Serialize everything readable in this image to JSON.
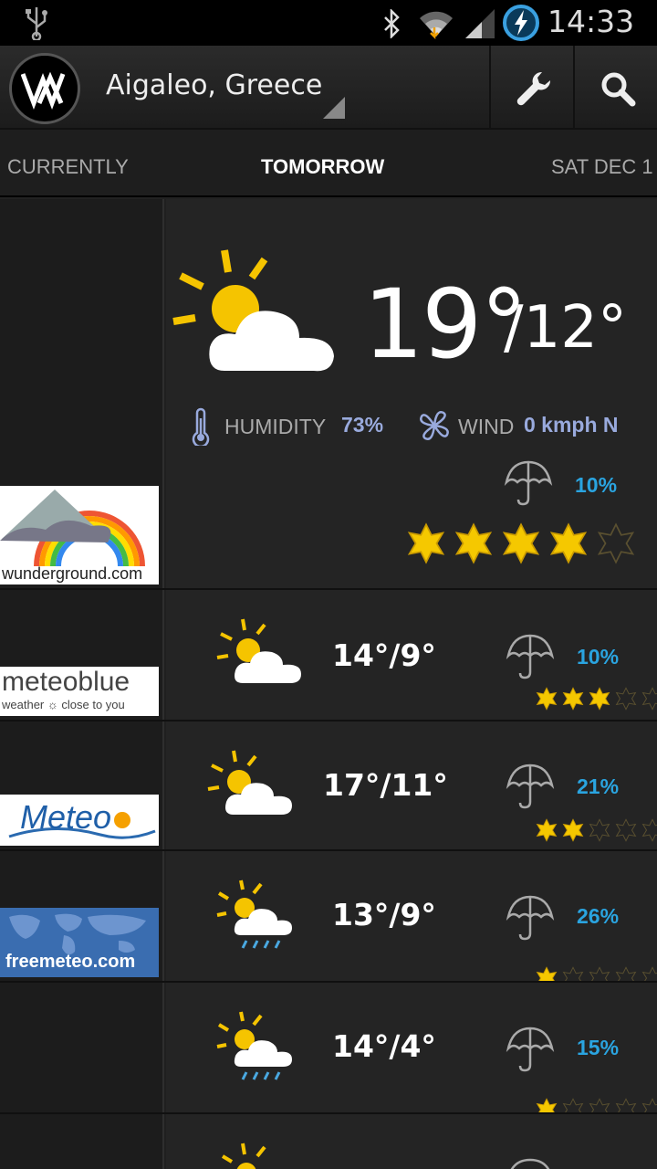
{
  "status_bar": {
    "time": "14:33",
    "icons": [
      "usb-icon",
      "bluetooth-icon",
      "wifi-icon",
      "signal-icon",
      "battery-charging-icon"
    ]
  },
  "action_bar": {
    "app_logo": "weather-mate-logo",
    "location": "Aigaleo, Greece",
    "settings_icon": "wrench-icon",
    "search_icon": "search-icon"
  },
  "tabs": [
    {
      "label": "CURRENTLY"
    },
    {
      "label": "TOMORROW"
    },
    {
      "label": "SAT DEC 1"
    }
  ],
  "featured": {
    "provider": "wunderground.com",
    "icon": "partly-cloudy-icon",
    "high": "19°",
    "low": "/12°",
    "humidity_label": "HUMIDITY",
    "humidity_value": "73%",
    "wind_label": "WIND",
    "wind_value": "0 kmph N",
    "rain_chance": "10%",
    "rating": 4
  },
  "forecasts": [
    {
      "provider": "meteoblue",
      "provider_tagline": "weather ☼ close to you",
      "icon": "partly-cloudy-icon",
      "temps": "14°/9°",
      "rain_chance": "10%",
      "rating": 3
    },
    {
      "provider": "Meteo",
      "icon": "partly-cloudy-icon",
      "temps": "17°/11°",
      "rain_chance": "21%",
      "rating": 2
    },
    {
      "provider": "freemeteo.com",
      "icon": "sun-cloud-rain-icon",
      "temps": "13°/9°",
      "rain_chance": "26%",
      "rating": 1
    },
    {
      "provider": "",
      "icon": "sun-cloud-rain-icon",
      "temps": "14°/4°",
      "rain_chance": "15%",
      "rating": 1
    }
  ]
}
